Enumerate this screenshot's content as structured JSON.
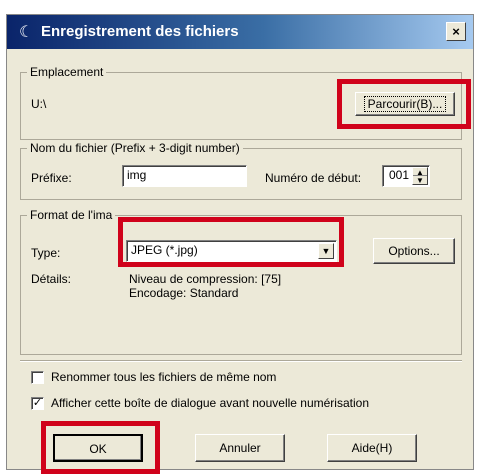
{
  "window": {
    "title": "Enregistrement des fichiers",
    "title_icon": "scanner-icon",
    "close_label": "×"
  },
  "location": {
    "legend": "Emplacement",
    "path": "U:\\",
    "browse_label": "Parcourir(B)..."
  },
  "filename": {
    "legend": "Nom du fichier (Prefix + 3-digit number)",
    "prefix_label": "Préfixe:",
    "prefix_value": "img",
    "start_label": "Numéro de début:",
    "start_value": "001"
  },
  "format": {
    "legend": "Format de l'ima",
    "type_label": "Type:",
    "type_value": "JPEG (*.jpg)",
    "options_label": "Options...",
    "details_label": "Détails:",
    "details_line1": "Niveau de compression: [75]",
    "details_line2": "Encodage: Standard"
  },
  "checkboxes": [
    {
      "label": "Renommer tous les fichiers de même nom",
      "checked": false
    },
    {
      "label": "Afficher cette boîte de dialogue avant nouvelle numérisation",
      "checked": true
    }
  ],
  "buttons": {
    "ok": "OK",
    "cancel": "Annuler",
    "help": "Aide(H)"
  },
  "highlight_color": "#d0021b"
}
